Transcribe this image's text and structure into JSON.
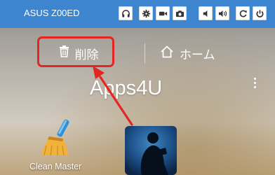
{
  "topbar": {
    "device_name": "ASUS Z00ED",
    "buttons": [
      {
        "icon": "headphones-icon"
      },
      {
        "icon": "gear-icon"
      },
      {
        "icon": "video-camera-icon"
      },
      {
        "icon": "camera-icon"
      },
      {
        "icon": "volume-down-icon"
      },
      {
        "icon": "volume-up-icon"
      },
      {
        "icon": "refresh-icon"
      },
      {
        "icon": "power-icon"
      }
    ]
  },
  "dropbar": {
    "delete_label": "削除",
    "delete_icon": "trash-icon",
    "home_label": "ホーム",
    "home_icon": "home-icon"
  },
  "folder": {
    "title": "Apps4U"
  },
  "apps": [
    {
      "label": "Clean Master",
      "icon": "broom-icon"
    },
    {
      "label": "",
      "icon": "kindle-reader-icon"
    }
  ],
  "colors": {
    "topbar_bg": "#3d86cf",
    "highlight": "#e32624"
  }
}
